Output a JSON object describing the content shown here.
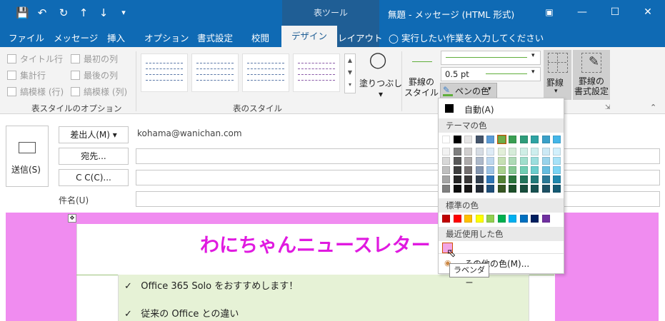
{
  "window": {
    "title": "無題 - メッセージ (HTML 形式)",
    "context_tab_header": "表ツール"
  },
  "quick_access": [
    "save-icon",
    "undo-icon",
    "redo-icon",
    "up-arrow-icon",
    "down-arrow-icon",
    "customize-icon"
  ],
  "tabs": [
    "ファイル",
    "メッセージ",
    "挿入",
    "オプション",
    "書式設定",
    "校閲",
    "デザイン",
    "レイアウト"
  ],
  "active_tab": "デザイン",
  "tell_me": "実行したい作業を入力してください",
  "ribbon": {
    "table_style_options": {
      "checkboxes": [
        "タイトル行",
        "最初の列",
        "集計行",
        "最後の列",
        "縞模様 (行)",
        "縞模様 (列)"
      ],
      "group_label": "表スタイルのオプション"
    },
    "table_styles": {
      "group_label": "表のスタイル",
      "shading_label": "塗りつぶし"
    },
    "borders": {
      "border_style_label": "罫線の\nスタイル",
      "pen_weight": "0.5 pt",
      "pen_color_label": "ペンの色",
      "borders_label": "罫線",
      "border_format_label": "罫線の\n書式設定"
    }
  },
  "compose": {
    "send_label": "送信(S)",
    "from_label": "差出人(M)",
    "from_value": "kohama@wanichan.com",
    "to_label": "宛先...",
    "cc_label": "C C(C)...",
    "subject_label": "件名(U)"
  },
  "body": {
    "newsletter_title": "わにちゃんニュースレター",
    "bullets": [
      "Office 365 Solo をおすすめします！",
      "従来の Office との違い"
    ]
  },
  "pen_color_menu": {
    "auto_label": "自動(A)",
    "theme_header": "テーマの色",
    "standard_header": "標準の色",
    "recent_header": "最近使用した色",
    "more_colors_label": "その他の色(M)...",
    "tooltip": "ラベンダー",
    "theme_top_row": [
      "#ffffff",
      "#000000",
      "#e7e6e6",
      "#44546a",
      "#5b9bd5",
      "#70ad47",
      "#3a9e52",
      "#2e9c7a",
      "#2ea3a3",
      "#3aa0c8",
      "#44b6e8"
    ],
    "standard_colors": [
      "#c00000",
      "#ff0000",
      "#ffc000",
      "#ffff00",
      "#92d050",
      "#00b050",
      "#00b0f0",
      "#0070c0",
      "#002060",
      "#7030a0"
    ],
    "recent_colors": [
      "#f2a5e6"
    ]
  }
}
